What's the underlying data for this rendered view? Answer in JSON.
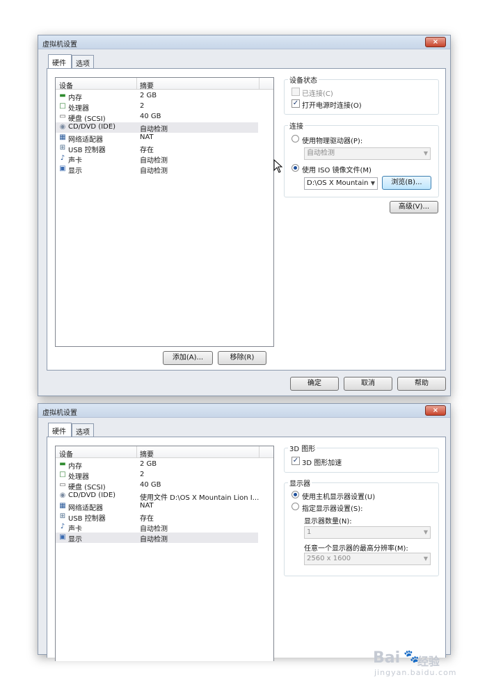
{
  "window1": {
    "title": "虚拟机设置",
    "close": "×",
    "tabs": [
      "硬件",
      "选项"
    ],
    "list_headers": {
      "device": "设备",
      "summary": "摘要"
    },
    "devices": [
      {
        "name": "内存",
        "summary": "2 GB",
        "icon": "memory-icon"
      },
      {
        "name": "处理器",
        "summary": "2",
        "icon": "processor-icon"
      },
      {
        "name": "硬盘 (SCSI)",
        "summary": "40 GB",
        "icon": "hard-disk-icon"
      },
      {
        "name": "CD/DVD (IDE)",
        "summary": "自动检测",
        "icon": "cd-dvd-icon"
      },
      {
        "name": "网络适配器",
        "summary": "NAT",
        "icon": "network-adapter-icon"
      },
      {
        "name": "USB 控制器",
        "summary": "存在",
        "icon": "usb-icon"
      },
      {
        "name": "声卡",
        "summary": "自动检测",
        "icon": "sound-card-icon"
      },
      {
        "name": "显示",
        "summary": "自动检测",
        "icon": "display-icon"
      }
    ],
    "add_button": "添加(A)...",
    "remove_button": "移除(R)",
    "device_status": {
      "label": "设备状态",
      "connected": "已连接(C)",
      "connect_at_power_on": "打开电源时连接(O)"
    },
    "connection": {
      "label": "连接",
      "physical_drive": "使用物理驱动器(P):",
      "physical_drive_value": "自动检测",
      "iso_image": "使用 ISO 镜像文件(M)",
      "iso_path": "D:\\OS X Mountain",
      "browse_button": "浏览(B)..."
    },
    "advanced_button": "高级(V)...",
    "ok_button": "确定",
    "cancel_button": "取消",
    "help_button": "帮助"
  },
  "window2": {
    "title": "虚拟机设置",
    "close": "×",
    "tabs": [
      "硬件",
      "选项"
    ],
    "list_headers": {
      "device": "设备",
      "summary": "摘要"
    },
    "devices": [
      {
        "name": "内存",
        "summary": "2 GB",
        "icon": "memory-icon"
      },
      {
        "name": "处理器",
        "summary": "2",
        "icon": "processor-icon"
      },
      {
        "name": "硬盘 (SCSI)",
        "summary": "40 GB",
        "icon": "hard-disk-icon"
      },
      {
        "name": "CD/DVD (IDE)",
        "summary": "使用文件 D:\\OS X Mountain Lion I...",
        "icon": "cd-dvd-icon"
      },
      {
        "name": "网络适配器",
        "summary": "NAT",
        "icon": "network-adapter-icon"
      },
      {
        "name": "USB 控制器",
        "summary": "存在",
        "icon": "usb-icon"
      },
      {
        "name": "声卡",
        "summary": "自动检测",
        "icon": "sound-card-icon"
      },
      {
        "name": "显示",
        "summary": "自动检测",
        "icon": "display-icon"
      }
    ],
    "graphics_3d": {
      "label": "3D 图形",
      "accelerate": "3D 图形加速"
    },
    "monitors": {
      "label": "显示器",
      "use_host": "使用主机显示器设置(U)",
      "specify": "指定显示器设置(S):",
      "count_label": "显示器数量(N):",
      "count_value": "1",
      "max_res_label": "任意一个显示器的最高分辨率(M):",
      "max_res_value": "2560 x 1600"
    }
  },
  "watermark": {
    "logo": "Bai",
    "logo_suffix": "经验",
    "url": "jingyan.baidu.com"
  }
}
